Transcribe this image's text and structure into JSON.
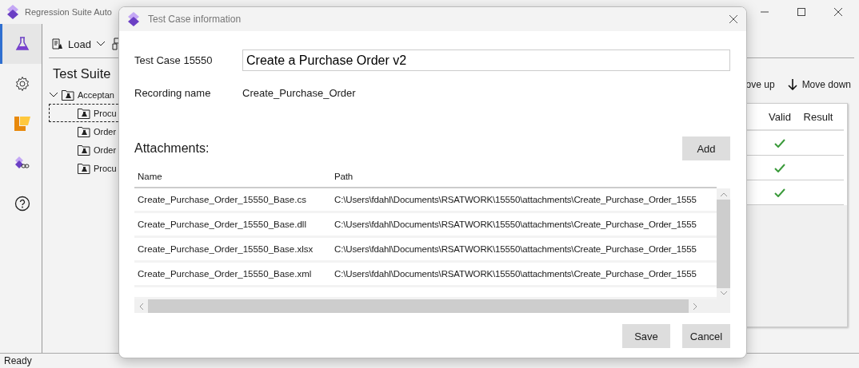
{
  "window": {
    "title": "Regression Suite Auto"
  },
  "rail": [
    {
      "kind": "flask",
      "selected": true
    },
    {
      "kind": "gear",
      "selected": false
    },
    {
      "kind": "logo",
      "selected": false
    },
    {
      "kind": "link",
      "selected": false
    },
    {
      "kind": "help",
      "selected": false
    }
  ],
  "toolbar": {
    "load": "Load"
  },
  "heading": "Test Suite",
  "tree": [
    {
      "label": "Acceptan",
      "expanded": true,
      "selected": false,
      "children": [
        {
          "label": "Procu",
          "selected": true
        },
        {
          "label": "Order",
          "selected": false
        },
        {
          "label": "Order",
          "selected": false
        },
        {
          "label": "Procu",
          "selected": false
        }
      ]
    }
  ],
  "actions": {
    "move_up": "ove up",
    "move_down": "Move down"
  },
  "cases_table": {
    "columns": [
      "Valid",
      "Result"
    ],
    "rows": [
      {
        "valid": true
      },
      {
        "valid": true
      },
      {
        "valid": true
      }
    ]
  },
  "status_bar": "Ready",
  "dialog": {
    "title": "Test Case information",
    "test_case_label": "Test Case 15550",
    "test_case_value": "Create a Purchase Order v2",
    "recording_label": "Recording name",
    "recording_value": "Create_Purchase_Order",
    "attachments_label": "Attachments:",
    "add": "Add",
    "columns": [
      "Name",
      "Path"
    ],
    "rows": [
      {
        "name": "Create_Purchase_Order_15550_Base.cs",
        "path": "C:\\Users\\fdahl\\Documents\\RSATWORK\\15550\\attachments\\Create_Purchase_Order_1555"
      },
      {
        "name": "Create_Purchase_Order_15550_Base.dll",
        "path": "C:\\Users\\fdahl\\Documents\\RSATWORK\\15550\\attachments\\Create_Purchase_Order_1555"
      },
      {
        "name": "Create_Purchase_Order_15550_Base.xlsx",
        "path": "C:\\Users\\fdahl\\Documents\\RSATWORK\\15550\\attachments\\Create_Purchase_Order_1555"
      },
      {
        "name": "Create_Purchase_Order_15550_Base.xml",
        "path": "C:\\Users\\fdahl\\Documents\\RSATWORK\\15550\\attachments\\Create_Purchase_Order_1555"
      }
    ],
    "save": "Save",
    "cancel": "Cancel"
  }
}
